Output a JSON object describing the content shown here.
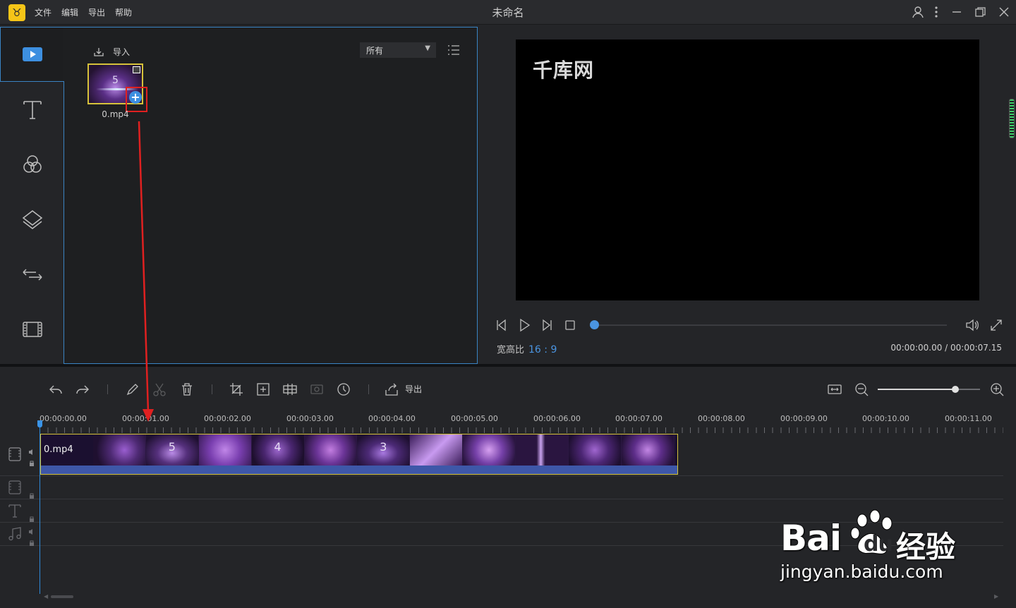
{
  "app": {
    "title": "未命名",
    "logo_glyph": "♉",
    "menu": [
      "文件",
      "编辑",
      "导出",
      "帮助"
    ]
  },
  "media_panel": {
    "import_label": "导入",
    "filter_selected": "所有",
    "items": [
      {
        "filename": "0.mp4",
        "thumb_number": "5"
      }
    ]
  },
  "preview": {
    "watermark": "千库网",
    "aspect_label": "宽高比",
    "aspect_value": "16 : 9",
    "current_time": "00:00:00.00",
    "total_time": "00:00:07.15",
    "timecode": "00:00:00.00 / 00:00:07.15",
    "progress": 0
  },
  "timeline": {
    "export_label": "导出",
    "zoom_level": 0.76,
    "ruler": [
      "00:00:00.00",
      "00:00:01.00",
      "00:00:02.00",
      "00:00:03.00",
      "00:00:04.00",
      "00:00:05.00",
      "00:00:06.00",
      "00:00:07.00",
      "00:00:08.00",
      "00:00:09.00",
      "00:00:10.00",
      "00:00:11.00"
    ],
    "clip": {
      "name": "0.mp4",
      "frame_numbers": [
        "",
        "5",
        "",
        "4",
        "",
        "3",
        "",
        "",
        "",
        "",
        "",
        ""
      ]
    }
  },
  "watermark": {
    "brand": "Bai",
    "brand2": "du",
    "cn": "经验",
    "url": "jingyan.baidu.com"
  },
  "colors": {
    "accent": "#3a84c4",
    "highlight": "#e02020",
    "clip_border": "#d6c23a",
    "audio_bar": "#3e57a8"
  }
}
